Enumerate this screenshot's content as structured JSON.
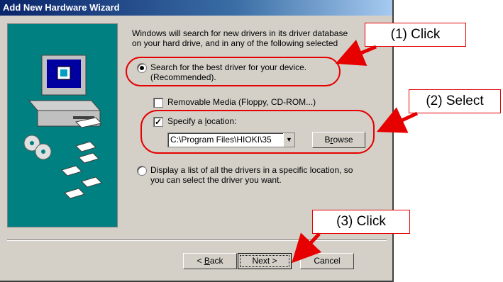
{
  "window": {
    "title": "Add New Hardware Wizard"
  },
  "intro_text": "Windows will search for new drivers in its driver database\non your hard drive, and in any of the following selected",
  "options": {
    "search_best": {
      "label": "Search for the best driver for your device.\n(Recommended).",
      "selected": true
    },
    "display_list": {
      "label": "Display a list of all the drivers in a specific location, so\nyou can select the driver you want.",
      "selected": false
    }
  },
  "checkboxes": {
    "removable_media": {
      "label": "Removable Media (Floppy, CD-ROM...)",
      "checked": false
    },
    "specify_location": {
      "label": "Specify a location:",
      "checked": true
    }
  },
  "location": {
    "value": "C:\\Program Files\\HIOKI\\35"
  },
  "buttons": {
    "browse": "Browse",
    "back": "< Back",
    "next": "Next >",
    "cancel": "Cancel"
  },
  "callouts": {
    "step1": "(1) Click",
    "step2": "(2) Select",
    "step3": "(3) Click"
  },
  "colors": {
    "highlight": "#e60000",
    "title_bar": "#0a246a",
    "side_panel": "#008080"
  }
}
